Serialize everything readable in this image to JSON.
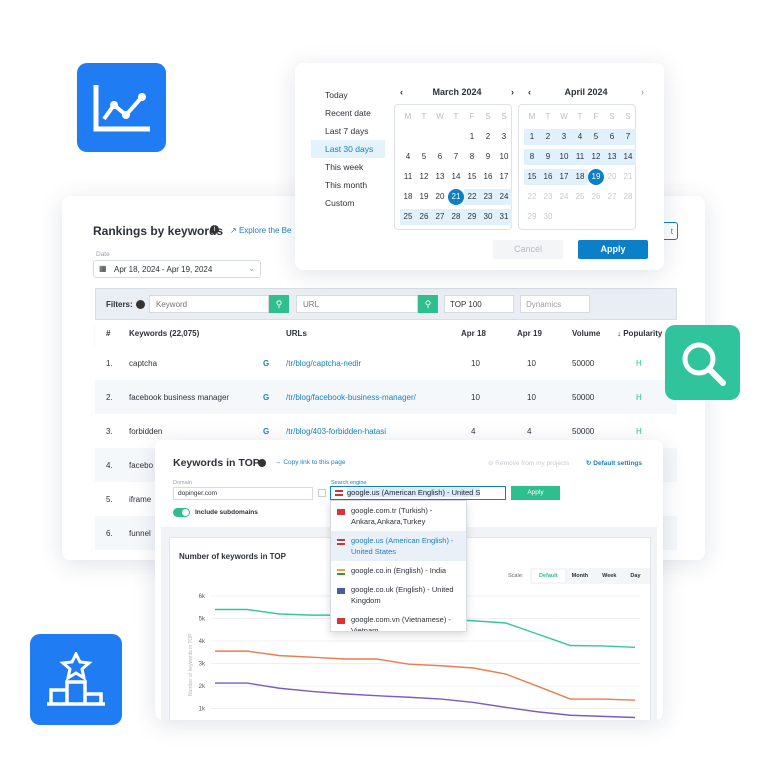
{
  "icons": {
    "analytics_tile": "line-chart-icon",
    "search_tile": "magnifier-icon",
    "ranking_tile": "podium-star-icon"
  },
  "colors": {
    "accent_blue": "#0b7fc7",
    "tile_blue": "#1f7cf2",
    "tile_green": "#2fc49b",
    "green": "#2fbf8f",
    "series_green": "#35c79a",
    "series_orange": "#ec7c4c",
    "series_purple": "#7b5cc4"
  },
  "calendar": {
    "presets": [
      "Today",
      "Recent date",
      "Last 7 days",
      "Last 30 days",
      "This week",
      "This month",
      "Custom"
    ],
    "active_preset": "Last 30 days",
    "weekdays": [
      "M",
      "T",
      "W",
      "T",
      "F",
      "S",
      "S"
    ],
    "months": [
      {
        "title": "March 2024",
        "lead": 4,
        "days": 31,
        "range_from": 21,
        "range_to": 31,
        "selected": 21
      },
      {
        "title": "April 2024",
        "lead": 0,
        "days": 30,
        "range_from": 1,
        "range_to": 19,
        "selected": 19
      }
    ],
    "cancel": "Cancel",
    "apply": "Apply"
  },
  "rankings": {
    "title": "Rankings by keywords",
    "explore": "Explore the Be",
    "right_btn": "t",
    "date_label": "Date",
    "date_value": "Apr 18, 2024 - Apr 19, 2024",
    "filters_label": "Filters:",
    "keyword_placeholder": "Keyword",
    "url_placeholder": "URL",
    "top_select": "TOP 100",
    "dynamics_select": "Dynamics",
    "columns": [
      "#",
      "Keywords (22,075)",
      "URLs",
      "Apr 18",
      "Apr 19",
      "Volume",
      "↓ Popularity"
    ],
    "rows": [
      {
        "n": "1.",
        "kw": "captcha",
        "url": "/tr/blog/captcha-nedir",
        "a": "10",
        "b": "10",
        "vol": "50000",
        "pop": "H"
      },
      {
        "n": "2.",
        "kw": "facebook business manager",
        "url": "/tr/blog/facebook-business-manager/",
        "a": "10",
        "b": "10",
        "vol": "50000",
        "pop": "H"
      },
      {
        "n": "3.",
        "kw": "forbidden",
        "url": "/tr/blog/403-forbidden-hatasi",
        "a": "4",
        "b": "4",
        "vol": "50000",
        "pop": "H"
      },
      {
        "n": "4.",
        "kw": "facebo"
      },
      {
        "n": "5.",
        "kw": "iframe"
      },
      {
        "n": "6.",
        "kw": "funnel"
      }
    ]
  },
  "top": {
    "title": "Keywords in TOP",
    "copy_link": "Copy link to this page",
    "remove": "Remove from my projects",
    "default_settings": "Default settings",
    "domain_label": "Domain",
    "domain_value": "dopinger.com",
    "engine_label": "Search engine",
    "engine_value": "google.us (American English) - United S",
    "apply": "Apply",
    "subdomains": "Include subdomains",
    "subdomains_on": true,
    "engine_options": [
      "google.com.tr (Turkish) - Ankara,Ankara,Turkey",
      "google.us (American English) - United States",
      "google.co.in (English) - India",
      "google.co.uk (English) - United Kingdom",
      "google.com.vn (Vietnamese) - Vietnam"
    ],
    "selected_option": 1,
    "chart_title": "Number of keywords in TOP",
    "scale_label": "Scale:",
    "scale_options": [
      "Default",
      "Month",
      "Week",
      "Day"
    ],
    "scale_active": "Default"
  },
  "chart_data": {
    "type": "line",
    "title": "Number of keywords in TOP",
    "ylabel": "Number of keywords in TOP",
    "xlabel": "",
    "yticks": [
      "6k",
      "5k",
      "4k",
      "3k",
      "2k",
      "1k"
    ],
    "ylim": [
      1000,
      6000
    ],
    "grid": true,
    "series": [
      {
        "color": "#35c79a",
        "values": [
          5400,
          5400,
          5200,
          5150,
          5150,
          5100,
          4950,
          4950,
          4900,
          4800,
          4300,
          3800,
          3780,
          3720
        ]
      },
      {
        "color": "#ec7c4c",
        "values": [
          3550,
          3550,
          3350,
          3280,
          3200,
          3200,
          2970,
          2900,
          2800,
          2530,
          1980,
          1420,
          1420,
          1370
        ]
      },
      {
        "color": "#7b5cc4",
        "values": [
          2130,
          2130,
          1900,
          1760,
          1650,
          1570,
          1500,
          1420,
          1270,
          1050,
          850,
          700,
          650,
          600
        ]
      }
    ]
  }
}
